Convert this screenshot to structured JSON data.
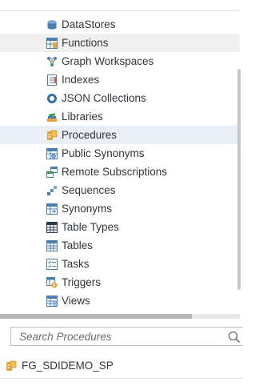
{
  "tree": {
    "items": [
      {
        "label": "DataStores",
        "icon": "datastore-icon"
      },
      {
        "label": "Functions",
        "icon": "function-icon"
      },
      {
        "label": "Graph Workspaces",
        "icon": "graph-icon"
      },
      {
        "label": "Indexes",
        "icon": "index-icon"
      },
      {
        "label": "JSON Collections",
        "icon": "json-icon"
      },
      {
        "label": "Libraries",
        "icon": "library-icon"
      },
      {
        "label": "Procedures",
        "icon": "procedure-icon"
      },
      {
        "label": "Public Synonyms",
        "icon": "public-synonym-icon"
      },
      {
        "label": "Remote Subscriptions",
        "icon": "remote-subscription-icon"
      },
      {
        "label": "Sequences",
        "icon": "sequence-icon"
      },
      {
        "label": "Synonyms",
        "icon": "synonym-icon"
      },
      {
        "label": "Table Types",
        "icon": "table-type-icon"
      },
      {
        "label": "Tables",
        "icon": "table-icon"
      },
      {
        "label": "Tasks",
        "icon": "task-icon"
      },
      {
        "label": "Triggers",
        "icon": "trigger-icon"
      },
      {
        "label": "Views",
        "icon": "view-icon"
      }
    ],
    "hovered": "Functions",
    "selected": "Procedures"
  },
  "search": {
    "placeholder": "Search Procedures",
    "value": "",
    "button_icon": "search-icon"
  },
  "results": [
    {
      "label": "FG_SDIDEMO_SP",
      "icon": "procedure-icon"
    }
  ],
  "colors": {
    "selected_bg": "#e8eff6",
    "hover_bg": "#f0f0f0",
    "text": "#32363a",
    "icon_blue": "#4a7fb5",
    "icon_orange": "#e8a33c"
  }
}
